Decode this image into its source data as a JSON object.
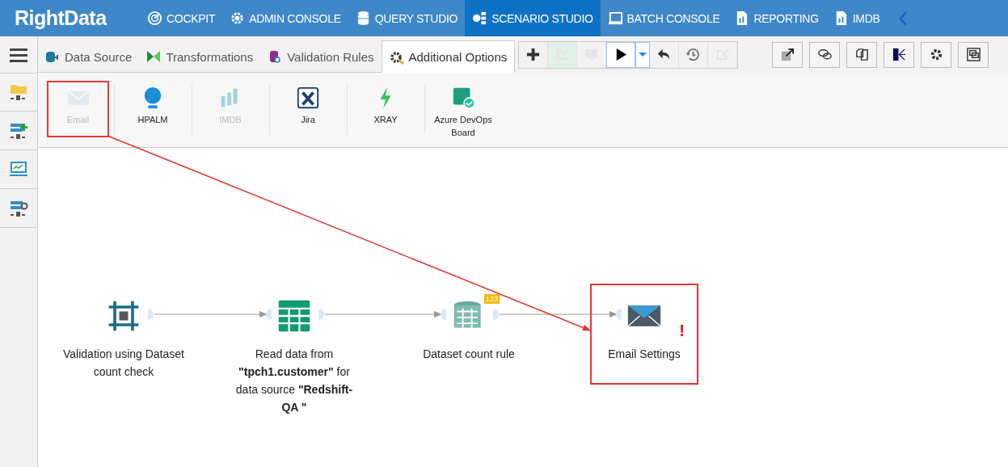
{
  "app": {
    "logo": "RightData"
  },
  "nav": [
    {
      "label": "COCKPIT",
      "selected": false
    },
    {
      "label": "ADMIN CONSOLE",
      "selected": false
    },
    {
      "label": "QUERY STUDIO",
      "selected": false
    },
    {
      "label": "SCENARIO STUDIO",
      "selected": true
    },
    {
      "label": "BATCH CONSOLE",
      "selected": false
    },
    {
      "label": "REPORTING",
      "selected": false
    },
    {
      "label": "IMDB",
      "selected": false
    }
  ],
  "tabs": [
    {
      "label": "Data Source",
      "selected": false
    },
    {
      "label": "Transformations",
      "selected": false
    },
    {
      "label": "Validation Rules",
      "selected": false
    },
    {
      "label": "Additional Options",
      "selected": true
    }
  ],
  "toolbar": [
    {
      "disabled": false
    },
    {
      "disabled": true
    },
    {
      "disabled": true
    },
    {
      "disabled": false
    },
    {
      "disabled": false
    },
    {
      "disabled": false
    },
    {
      "disabled": false
    },
    {
      "disabled": true
    }
  ],
  "toolbar_right": [
    {
      "disabled": false
    },
    {
      "disabled": false
    },
    {
      "disabled": false
    },
    {
      "disabled": false
    },
    {
      "disabled": false
    },
    {
      "disabled": false
    }
  ],
  "ribbon": [
    {
      "label": "Email",
      "disabled": true,
      "highlighted": true
    },
    {
      "label": "HPALM",
      "disabled": false,
      "highlighted": false
    },
    {
      "label": "IMDB",
      "disabled": true,
      "highlighted": false
    },
    {
      "label": "Jira",
      "disabled": false,
      "highlighted": false
    },
    {
      "label": "XRAY",
      "disabled": false,
      "highlighted": false
    },
    {
      "label": "Azure DevOps Board",
      "disabled": false,
      "highlighted": false
    }
  ],
  "nodes": [
    {
      "kind": "validation",
      "label": "Validation using Dataset count check",
      "highlighted": false
    },
    {
      "kind": "read",
      "label": "Read data from **\"tpch1.customer\"** for data source **\"Redshift-QA \"**",
      "highlighted": false
    },
    {
      "kind": "count",
      "label": "Dataset count rule",
      "badge": "123",
      "highlighted": false
    },
    {
      "kind": "email",
      "label": "Email Settings",
      "alert": "!",
      "highlighted": true
    }
  ]
}
